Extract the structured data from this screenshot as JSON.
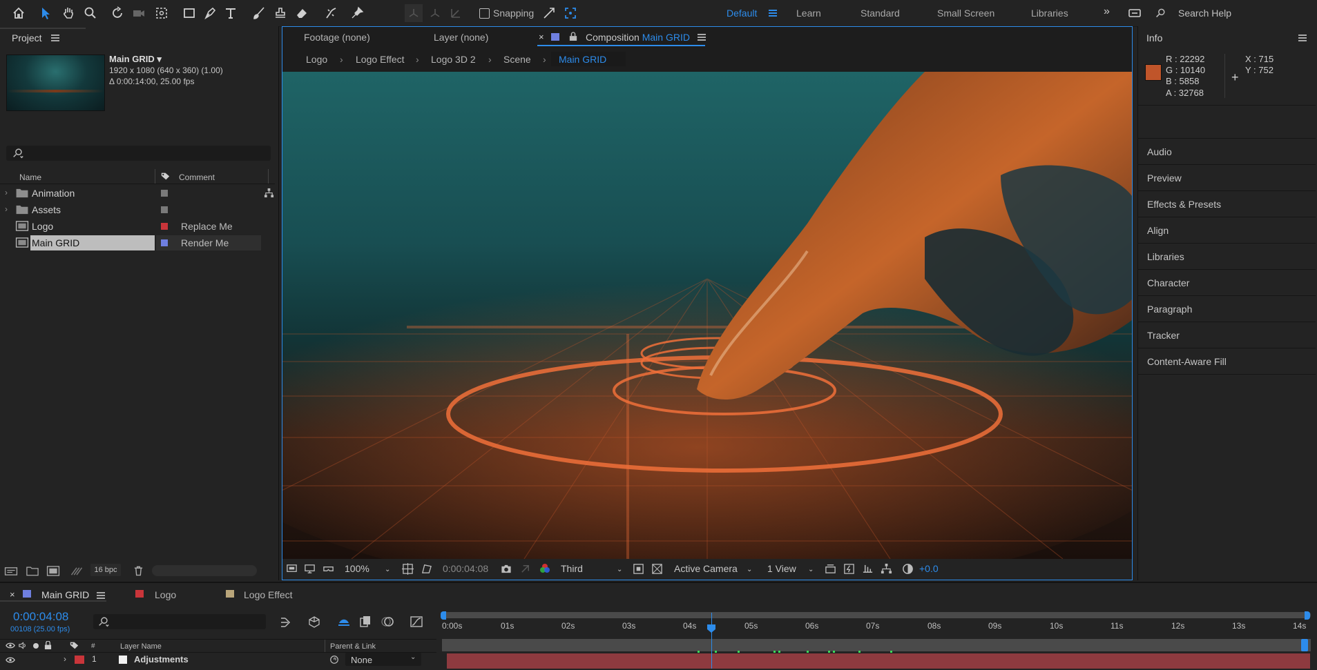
{
  "toolbar": {
    "snapping_label": "Snapping",
    "search_placeholder": "Search Help",
    "workspaces": [
      "Default",
      "Learn",
      "Standard",
      "Small Screen",
      "Libraries"
    ],
    "more": "»"
  },
  "project": {
    "title": "Project",
    "comp_name": "Main GRID ▾",
    "comp_size": "1920 x 1080  (640 x 360) (1.00)",
    "comp_duration": "Δ 0:00:14:00, 25.00 fps",
    "col_name": "Name",
    "col_comment": "Comment",
    "items": [
      {
        "name": "Animation",
        "comment": "",
        "label_color": "#7a7a7a"
      },
      {
        "name": "Assets",
        "comment": "",
        "label_color": "#7a7a7a"
      },
      {
        "name": "Logo",
        "comment": "Replace Me",
        "label_color": "#c9353a"
      },
      {
        "name": "Main GRID",
        "comment": "Render Me",
        "label_color": "#6f7fe0"
      }
    ],
    "bpc": "16 bpc"
  },
  "viewer": {
    "tabs": [
      {
        "label": "Footage  (none)"
      },
      {
        "label": "Layer  (none)"
      },
      {
        "label": "Composition",
        "accent": "Main GRID"
      }
    ],
    "breadcrumbs": [
      "Logo",
      "Logo Effect",
      "Logo 3D 2",
      "Scene",
      "Main GRID"
    ],
    "zoom": "100%",
    "timecode": "0:00:04:08",
    "resolution": "Third",
    "camera": "Active Camera",
    "views": "1 View",
    "exposure": "+0.0"
  },
  "info": {
    "title": "Info",
    "r": "R :  22292",
    "g": "G :  10140",
    "b": "B :  5858",
    "a": "A :  32768",
    "x": "X : 715",
    "y": "Y : 752",
    "swatch": "#c0552a"
  },
  "right_panels": [
    "Audio",
    "Preview",
    "Effects & Presets",
    "Align",
    "Libraries",
    "Character",
    "Paragraph",
    "Tracker",
    "Content-Aware Fill"
  ],
  "timeline": {
    "tabs": [
      {
        "label": "Main GRID",
        "color": "#6f7fe0"
      },
      {
        "label": "Logo",
        "color": "#c9353a"
      },
      {
        "label": "Logo Effect",
        "color": "#b9a57a"
      }
    ],
    "timecode": "0:00:04:08",
    "frames": "00108 (25.00 fps)",
    "ticks": [
      "0:00s",
      "01s",
      "02s",
      "03s",
      "04s",
      "05s",
      "06s",
      "07s",
      "08s",
      "09s",
      "10s",
      "11s",
      "12s",
      "13s",
      "14s"
    ],
    "col_num": "#",
    "col_layer": "Layer Name",
    "col_parent": "Parent & Link",
    "layer": {
      "num": "1",
      "name": "Adjustments",
      "parent": "None"
    }
  },
  "colors": {
    "accent": "#2d8ceb",
    "bg": "#232323"
  }
}
